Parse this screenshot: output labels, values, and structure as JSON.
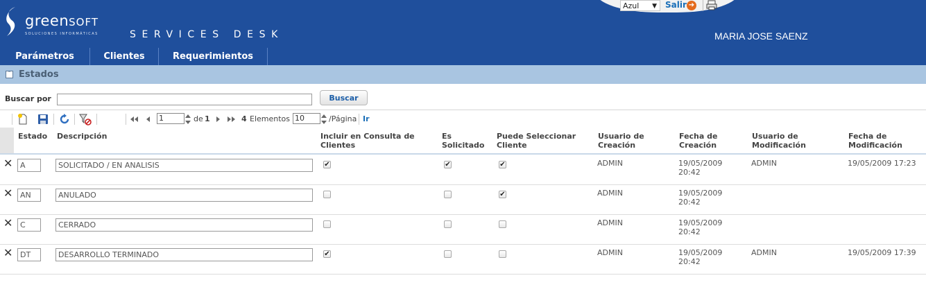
{
  "header": {
    "logo_main": "green",
    "logo_sub": "SOFT",
    "logo_tagline": "SOLUCIONES INFORMÁTICAS",
    "app_title": "SERVICES DESK",
    "user_name": "MARIA JOSE SAENZ",
    "theme_value": "Azul",
    "logout_label": "Salir"
  },
  "menu": [
    {
      "label": "Parámetros"
    },
    {
      "label": "Clientes"
    },
    {
      "label": "Requerimientos"
    }
  ],
  "section": {
    "title": "Estados"
  },
  "search": {
    "label": "Buscar por",
    "value": "",
    "button_label": "Buscar"
  },
  "pager": {
    "page": "1",
    "of_label": "de",
    "total_pages": "1",
    "count": "4",
    "elements_label": "Elementos",
    "page_size": "10",
    "per_page_label": "/Página",
    "go_label": "Ir"
  },
  "grid": {
    "columns": [
      "Estado",
      "Descripción",
      "Incluir en Consulta de Clientes",
      "Es Solicitado",
      "Puede Seleccionar Cliente",
      "Usuario de Creación",
      "Fecha de Creación",
      "Usuario de Modificación",
      "Fecha de Modificación"
    ],
    "rows": [
      {
        "estado": "A",
        "descripcion": "SOLICITADO / EN ANALISIS",
        "incluir": true,
        "solicitado": true,
        "seleccionar": true,
        "usuario_creacion": "ADMIN",
        "fecha_creacion": "19/05/2009 20:42",
        "usuario_modificacion": "ADMIN",
        "fecha_modificacion": "19/05/2009 17:23"
      },
      {
        "estado": "AN",
        "descripcion": "ANULADO",
        "incluir": false,
        "solicitado": false,
        "seleccionar": true,
        "usuario_creacion": "ADMIN",
        "fecha_creacion": "19/05/2009 20:42",
        "usuario_modificacion": "",
        "fecha_modificacion": ""
      },
      {
        "estado": "C",
        "descripcion": "CERRADO",
        "incluir": false,
        "solicitado": false,
        "seleccionar": false,
        "usuario_creacion": "ADMIN",
        "fecha_creacion": "19/05/2009 20:42",
        "usuario_modificacion": "",
        "fecha_modificacion": ""
      },
      {
        "estado": "DT",
        "descripcion": "DESARROLLO TERMINADO",
        "incluir": true,
        "solicitado": false,
        "seleccionar": false,
        "usuario_creacion": "ADMIN",
        "fecha_creacion": "19/05/2009 20:42",
        "usuario_modificacion": "ADMIN",
        "fecha_modificacion": "19/05/2009 17:39"
      }
    ]
  },
  "colors": {
    "header_bg": "#1f4f9c",
    "section_bg": "#a9c5e1",
    "link": "#1b6fb8"
  }
}
